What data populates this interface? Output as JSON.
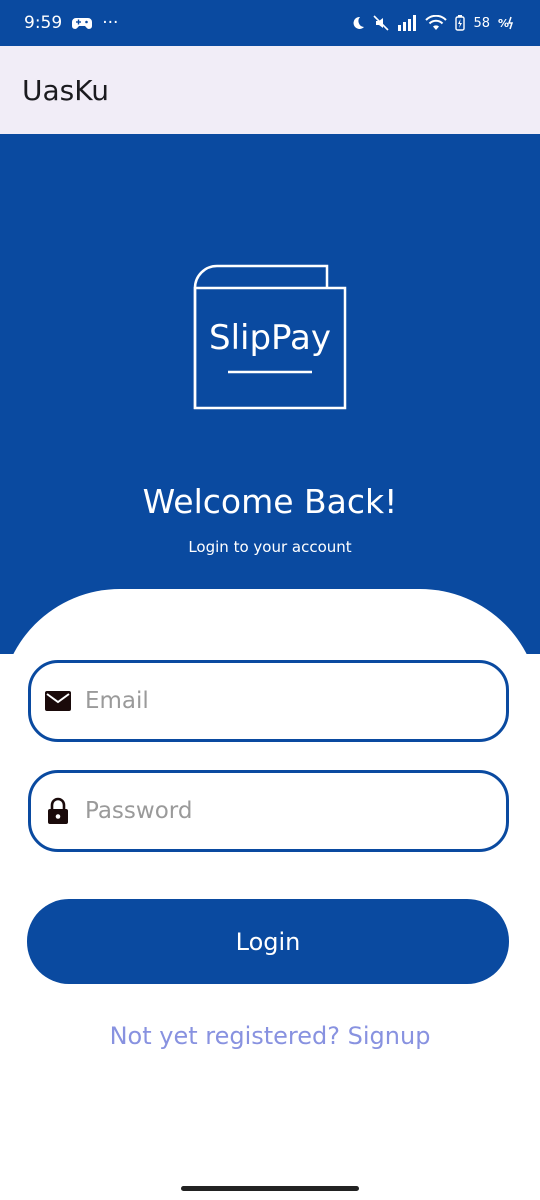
{
  "status_bar": {
    "time": "9:59",
    "dots": "···",
    "battery": "58",
    "icons": [
      "moon-icon",
      "mute-icon",
      "signal-icon",
      "wifi-icon",
      "battery-icon",
      "data-icon"
    ]
  },
  "app_bar": {
    "title": "UasKu"
  },
  "hero": {
    "logo_text": "SlipPay",
    "welcome": "Welcome Back!",
    "subtitle": "Login to your account"
  },
  "form": {
    "email_placeholder": "Email",
    "password_placeholder": "Password",
    "login_label": "Login",
    "signup_link": "Not yet registered? Signup"
  },
  "colors": {
    "primary": "#0a4aa0",
    "app_bar_bg": "#f1edf7",
    "link": "#8892e0"
  }
}
